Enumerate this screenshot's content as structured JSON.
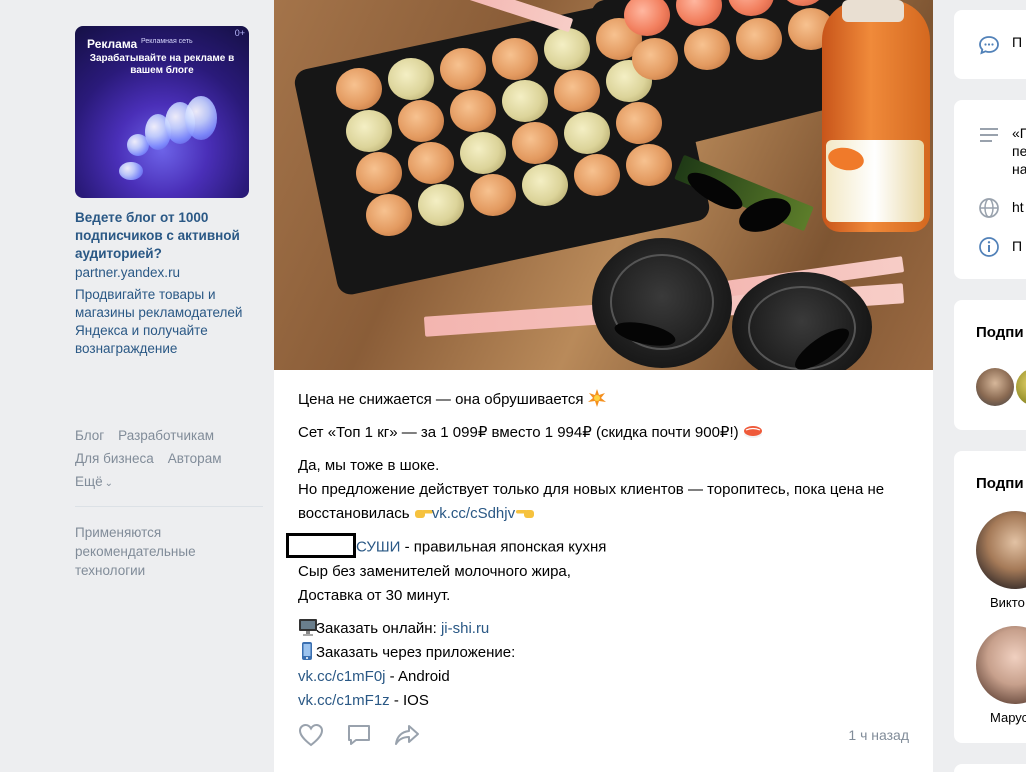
{
  "ad": {
    "badge": "Реклама",
    "network_label": "Рекламная сеть",
    "corner": "0+",
    "image_headline": "Зарабатывайте на рекламе в вашем блоге",
    "title": "Ведете блог от 1000 подписчиков с активной аудиторией?",
    "domain": "partner.yandex.ru",
    "text": "Продвигайте товары и магазины рекламодателей Яндекса и получайте вознаграждение"
  },
  "footer": {
    "links": [
      "Блог",
      "Разработчикам",
      "Для бизнеса",
      "Авторам"
    ],
    "more": "Ещё",
    "rec_note": "Применяются рекомендательные технологии"
  },
  "post": {
    "line1": "Цена не снижается — она обрушивается",
    "line2": "Сет «Топ 1 кг» — за 1 099₽ вместо 1 994₽ (скидка почти 900₽!)",
    "line3a": "Да, мы тоже в шоке.",
    "line3b": "Но предложение действует только для новых клиентов — торопитесь, пока цена не восстановилась",
    "link1": "vk.cc/cSdhjv",
    "brand": "СУШИ",
    "brand_rest": " - правильная японская кухня",
    "line5": "Сыр без заменителей молочного жира,",
    "line6": "Доставка от 30 минут.",
    "order_online": "Заказать онлайн: ",
    "order_online_link": "ji-shi.ru",
    "order_app": "Заказать через приложение:",
    "android_link": "vk.cc/c1mF0j",
    "android_label": " - Android",
    "ios_link": "vk.cc/c1mF1z",
    "ios_label": " - IOS",
    "time": "1 ч назад"
  },
  "right": {
    "card1_text": "П",
    "card2_quote": "«Г\nпе\nна",
    "card2_link": "ht",
    "card2_info": "П",
    "subs_header1": "Подпи",
    "subs_header2": "Подпи",
    "person1": "Викто",
    "person2": "Марус"
  },
  "colors": {
    "link": "#2a5885",
    "muted": "#818c99",
    "background": "#edeef0",
    "icon_blue": "#5181b8"
  }
}
